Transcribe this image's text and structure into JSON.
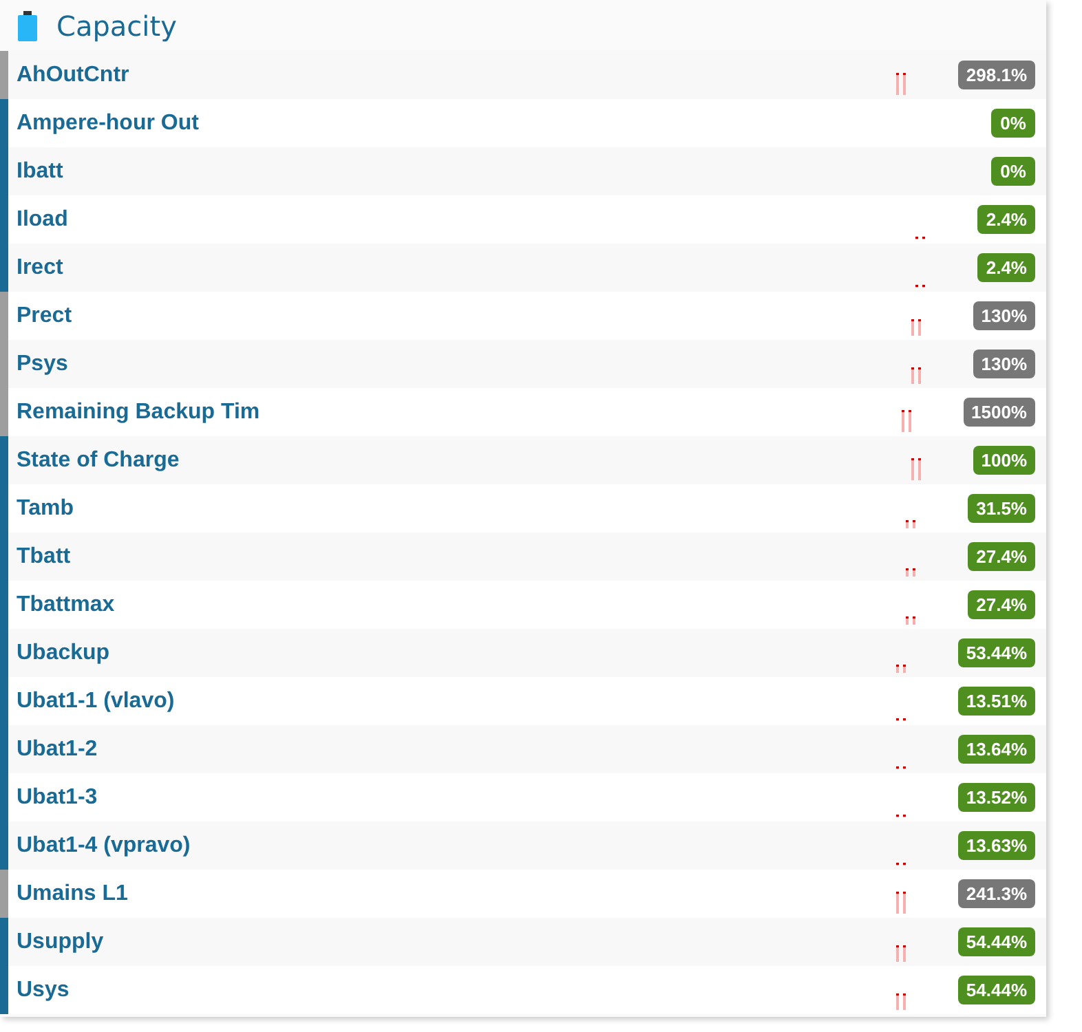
{
  "panel": {
    "title": "Capacity"
  },
  "rows": [
    {
      "name": "AhOutCntr",
      "value": "298.1%",
      "color": "#777777",
      "kind": "high"
    },
    {
      "name": "Ampere-hour Out",
      "value": "0%",
      "color": "#4e8f1f",
      "kind": "none"
    },
    {
      "name": "Ibatt",
      "value": "0%",
      "color": "#4e8f1f",
      "kind": "none"
    },
    {
      "name": "Iload",
      "value": "2.4%",
      "color": "#4e8f1f",
      "kind": "flat"
    },
    {
      "name": "Irect",
      "value": "2.4%",
      "color": "#4e8f1f",
      "kind": "flat"
    },
    {
      "name": "Prect",
      "value": "130%",
      "color": "#777777",
      "kind": "mid"
    },
    {
      "name": "Psys",
      "value": "130%",
      "color": "#777777",
      "kind": "mid"
    },
    {
      "name": "Remaining Backup Tim",
      "value": "1500%",
      "color": "#777777",
      "kind": "high"
    },
    {
      "name": "State of Charge",
      "value": "100%",
      "color": "#4e8f1f",
      "kind": "high"
    },
    {
      "name": "Tamb",
      "value": "31.5%",
      "color": "#4e8f1f",
      "kind": "low"
    },
    {
      "name": "Tbatt",
      "value": "27.4%",
      "color": "#4e8f1f",
      "kind": "low"
    },
    {
      "name": "Tbattmax",
      "value": "27.4%",
      "color": "#4e8f1f",
      "kind": "low"
    },
    {
      "name": "Ubackup",
      "value": "53.44%",
      "color": "#4e8f1f",
      "kind": "low"
    },
    {
      "name": "Ubat1-1 (vlavo)",
      "value": "13.51%",
      "color": "#4e8f1f",
      "kind": "flat"
    },
    {
      "name": "Ubat1-2",
      "value": "13.64%",
      "color": "#4e8f1f",
      "kind": "flat"
    },
    {
      "name": "Ubat1-3",
      "value": "13.52%",
      "color": "#4e8f1f",
      "kind": "flat"
    },
    {
      "name": "Ubat1-4 (vpravo)",
      "value": "13.63%",
      "color": "#4e8f1f",
      "kind": "flat"
    },
    {
      "name": "Umains L1",
      "value": "241.3%",
      "color": "#777777",
      "kind": "high"
    },
    {
      "name": "Usupply",
      "value": "54.44%",
      "color": "#4e8f1f",
      "kind": "mid"
    },
    {
      "name": "Usys",
      "value": "54.44%",
      "color": "#4e8f1f",
      "kind": "mid"
    }
  ]
}
